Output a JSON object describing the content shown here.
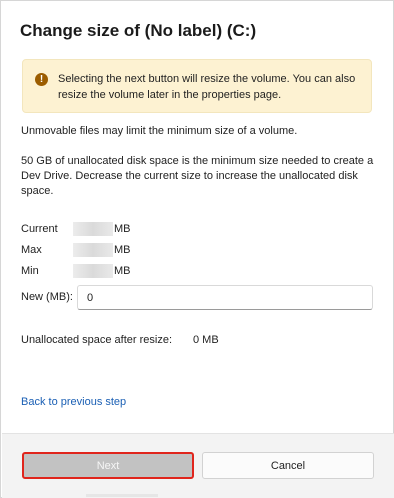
{
  "dialog": {
    "title": "Change size of (No label) (C:)"
  },
  "banner": {
    "icon": "warning-icon",
    "icon_glyph": "!",
    "text": "Selecting the next button will resize the volume. You can also resize the volume later in the properties page."
  },
  "info": {
    "line1": "Unmovable files may limit the minimum size of a volume.",
    "line2": "50 GB of unallocated disk space is the minimum size needed to create a Dev Drive. Decrease the current size to increase the unallocated disk space."
  },
  "sizes": {
    "current_label": "Current",
    "max_label": "Max",
    "min_label": "Min",
    "unit": "MB"
  },
  "new_size": {
    "label": "New (MB):",
    "value": "0"
  },
  "unallocated": {
    "label": "Unallocated space after resize:",
    "value": "0 MB"
  },
  "back_link": "Back to previous step",
  "buttons": {
    "next": "Next",
    "cancel": "Cancel"
  },
  "colors": {
    "banner_bg": "#fdf2d2",
    "warning_icon": "#9c5d00",
    "link": "#1a5fb4",
    "highlight_border": "#e0251c",
    "disabled_button": "#c2c2c2"
  }
}
